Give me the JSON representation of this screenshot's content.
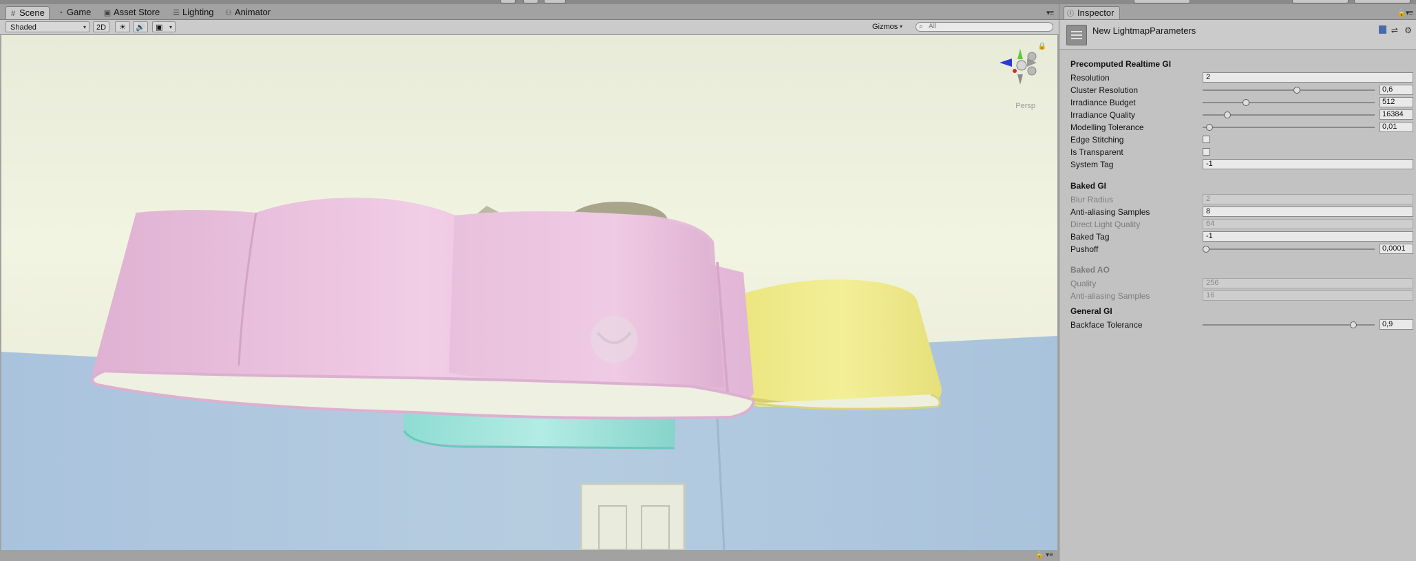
{
  "scene_tabs": [
    {
      "label": "Scene",
      "icon": "grid-icon"
    },
    {
      "label": "Game",
      "icon": "pacman-icon"
    },
    {
      "label": "Asset Store",
      "icon": "store-icon"
    },
    {
      "label": "Lighting",
      "icon": "list-icon"
    },
    {
      "label": "Animator",
      "icon": "animator-icon"
    }
  ],
  "toolbar": {
    "draw_mode": "Shaded",
    "mode_2d": "2D",
    "gizmos": "Gizmos",
    "search_placeholder": "All"
  },
  "viewport": {
    "projection_label": "Persp"
  },
  "inspector": {
    "tab_label": "Inspector",
    "title": "New LightmapParameters",
    "sections": {
      "precomputed": "Precomputed Realtime GI",
      "baked_gi": "Baked GI",
      "baked_ao": "Baked AO",
      "general_gi": "General GI"
    },
    "precomputed": {
      "resolution": {
        "label": "Resolution",
        "value": "2"
      },
      "cluster_resolution": {
        "label": "Cluster Resolution",
        "value": "0,6",
        "level": 0.55
      },
      "irradiance_budget": {
        "label": "Irradiance Budget",
        "value": "512",
        "level": 0.24
      },
      "irradiance_quality": {
        "label": "Irradiance Quality",
        "value": "16384",
        "level": 0.13
      },
      "modelling_tolerance": {
        "label": "Modelling Tolerance",
        "value": "0,01",
        "level": 0.02
      },
      "edge_stitching": {
        "label": "Edge Stitching",
        "checked": false
      },
      "is_transparent": {
        "label": "Is Transparent",
        "checked": false
      },
      "system_tag": {
        "label": "System Tag",
        "value": "-1"
      }
    },
    "baked_gi": {
      "blur_radius": {
        "label": "Blur Radius",
        "value": "2"
      },
      "aa_samples": {
        "label": "Anti-aliasing Samples",
        "value": "8"
      },
      "direct_light_quality": {
        "label": "Direct Light Quality",
        "value": "64"
      },
      "baked_tag": {
        "label": "Baked Tag",
        "value": "-1"
      },
      "pushoff": {
        "label": "Pushoff",
        "value": "0,0001",
        "level": 0.0
      }
    },
    "baked_ao": {
      "quality": {
        "label": "Quality",
        "value": "256"
      },
      "aa_samples": {
        "label": "Anti-aliasing Samples",
        "value": "16"
      }
    },
    "general_gi": {
      "backface_tolerance": {
        "label": "Backface Tolerance",
        "value": "0,9",
        "level": 0.89
      }
    }
  }
}
